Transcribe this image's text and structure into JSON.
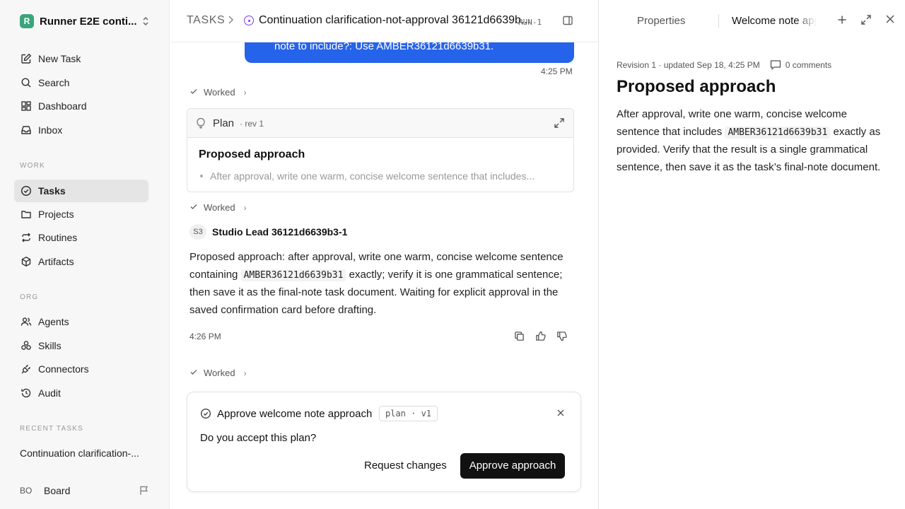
{
  "workspace": {
    "logo_letter": "R",
    "name": "Runner E2E conti..."
  },
  "nav": {
    "main": [
      {
        "id": "new-task",
        "label": "New Task",
        "icon": "pencil-square-icon"
      },
      {
        "id": "search",
        "label": "Search",
        "icon": "search-icon"
      },
      {
        "id": "dashboard",
        "label": "Dashboard",
        "icon": "dashboard-grid-icon"
      },
      {
        "id": "inbox",
        "label": "Inbox",
        "icon": "inbox-icon"
      }
    ],
    "work_label": "WORK",
    "work": [
      {
        "id": "tasks",
        "label": "Tasks",
        "icon": "check-circle-icon",
        "active": true
      },
      {
        "id": "projects",
        "label": "Projects",
        "icon": "folder-icon"
      },
      {
        "id": "routines",
        "label": "Routines",
        "icon": "repeat-icon"
      },
      {
        "id": "artifacts",
        "label": "Artifacts",
        "icon": "box-icon"
      }
    ],
    "org_label": "ORG",
    "org": [
      {
        "id": "agents",
        "label": "Agents",
        "icon": "users-icon"
      },
      {
        "id": "skills",
        "label": "Skills",
        "icon": "skills-icon"
      },
      {
        "id": "connectors",
        "label": "Connectors",
        "icon": "plug-icon"
      },
      {
        "id": "audit",
        "label": "Audit",
        "icon": "history-icon"
      }
    ],
    "recent_label": "RECENT TASKS",
    "recent": [
      "Continuation clarification-..."
    ]
  },
  "user": {
    "initials": "BO",
    "name": "Board"
  },
  "header": {
    "section": "TASKS",
    "title": "Continuation clarification-not-approval 36121d6639b...",
    "run_badge": "RUN-1"
  },
  "thread": {
    "user_bubble_text": "note to include?: Use AMBER36121d6639b31.",
    "user_time": "4:25 PM",
    "worked_label": "Worked",
    "plan_card": {
      "label": "Plan",
      "rev": "· rev 1",
      "title": "Proposed approach",
      "bullet": "After approval, write one warm, concise welcome sentence that includes..."
    },
    "agent": {
      "initials": "S3",
      "name": "Studio Lead 36121d6639b3-1",
      "msg_before": "Proposed approach: after approval, write one warm, concise welcome sentence containing ",
      "msg_code": "AMBER36121d6639b31",
      "msg_after": " exactly; verify it is one grammatical sentence; then save it as the final-note task document. Waiting for explicit approval in the saved confirmation card before drafting.",
      "time": "4:26 PM"
    },
    "approval": {
      "title": "Approve welcome note approach",
      "badge": "plan · v1",
      "question": "Do you accept this plan?",
      "request_label": "Request changes",
      "approve_label": "Approve approach"
    }
  },
  "panel": {
    "tab_properties": "Properties",
    "tab_doc": "Welcome note approach",
    "meta": "Revision 1 · updated Sep 18, 4:25 PM",
    "comments": "0 comments",
    "title": "Proposed approach",
    "body_before": "After approval, write one warm, concise welcome sentence that includes ",
    "body_code": "AMBER36121d6639b31",
    "body_after": " exactly as provided. Verify that the result is a single grammatical sentence, then save it as the task’s final-note document."
  },
  "colors": {
    "accent": "#2563eb",
    "primary_button": "#111111",
    "status_running": "#7c3aed",
    "logo": "#3aa57a"
  }
}
